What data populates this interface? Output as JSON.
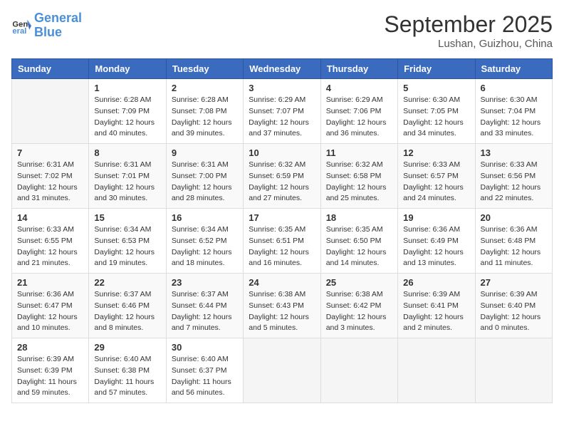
{
  "header": {
    "logo_line1": "General",
    "logo_line2": "Blue",
    "month": "September 2025",
    "location": "Lushan, Guizhou, China"
  },
  "days_of_week": [
    "Sunday",
    "Monday",
    "Tuesday",
    "Wednesday",
    "Thursday",
    "Friday",
    "Saturday"
  ],
  "weeks": [
    [
      {
        "day": "",
        "info": ""
      },
      {
        "day": "1",
        "info": "Sunrise: 6:28 AM\nSunset: 7:09 PM\nDaylight: 12 hours\nand 40 minutes."
      },
      {
        "day": "2",
        "info": "Sunrise: 6:28 AM\nSunset: 7:08 PM\nDaylight: 12 hours\nand 39 minutes."
      },
      {
        "day": "3",
        "info": "Sunrise: 6:29 AM\nSunset: 7:07 PM\nDaylight: 12 hours\nand 37 minutes."
      },
      {
        "day": "4",
        "info": "Sunrise: 6:29 AM\nSunset: 7:06 PM\nDaylight: 12 hours\nand 36 minutes."
      },
      {
        "day": "5",
        "info": "Sunrise: 6:30 AM\nSunset: 7:05 PM\nDaylight: 12 hours\nand 34 minutes."
      },
      {
        "day": "6",
        "info": "Sunrise: 6:30 AM\nSunset: 7:04 PM\nDaylight: 12 hours\nand 33 minutes."
      }
    ],
    [
      {
        "day": "7",
        "info": "Sunrise: 6:31 AM\nSunset: 7:02 PM\nDaylight: 12 hours\nand 31 minutes."
      },
      {
        "day": "8",
        "info": "Sunrise: 6:31 AM\nSunset: 7:01 PM\nDaylight: 12 hours\nand 30 minutes."
      },
      {
        "day": "9",
        "info": "Sunrise: 6:31 AM\nSunset: 7:00 PM\nDaylight: 12 hours\nand 28 minutes."
      },
      {
        "day": "10",
        "info": "Sunrise: 6:32 AM\nSunset: 6:59 PM\nDaylight: 12 hours\nand 27 minutes."
      },
      {
        "day": "11",
        "info": "Sunrise: 6:32 AM\nSunset: 6:58 PM\nDaylight: 12 hours\nand 25 minutes."
      },
      {
        "day": "12",
        "info": "Sunrise: 6:33 AM\nSunset: 6:57 PM\nDaylight: 12 hours\nand 24 minutes."
      },
      {
        "day": "13",
        "info": "Sunrise: 6:33 AM\nSunset: 6:56 PM\nDaylight: 12 hours\nand 22 minutes."
      }
    ],
    [
      {
        "day": "14",
        "info": "Sunrise: 6:33 AM\nSunset: 6:55 PM\nDaylight: 12 hours\nand 21 minutes."
      },
      {
        "day": "15",
        "info": "Sunrise: 6:34 AM\nSunset: 6:53 PM\nDaylight: 12 hours\nand 19 minutes."
      },
      {
        "day": "16",
        "info": "Sunrise: 6:34 AM\nSunset: 6:52 PM\nDaylight: 12 hours\nand 18 minutes."
      },
      {
        "day": "17",
        "info": "Sunrise: 6:35 AM\nSunset: 6:51 PM\nDaylight: 12 hours\nand 16 minutes."
      },
      {
        "day": "18",
        "info": "Sunrise: 6:35 AM\nSunset: 6:50 PM\nDaylight: 12 hours\nand 14 minutes."
      },
      {
        "day": "19",
        "info": "Sunrise: 6:36 AM\nSunset: 6:49 PM\nDaylight: 12 hours\nand 13 minutes."
      },
      {
        "day": "20",
        "info": "Sunrise: 6:36 AM\nSunset: 6:48 PM\nDaylight: 12 hours\nand 11 minutes."
      }
    ],
    [
      {
        "day": "21",
        "info": "Sunrise: 6:36 AM\nSunset: 6:47 PM\nDaylight: 12 hours\nand 10 minutes."
      },
      {
        "day": "22",
        "info": "Sunrise: 6:37 AM\nSunset: 6:46 PM\nDaylight: 12 hours\nand 8 minutes."
      },
      {
        "day": "23",
        "info": "Sunrise: 6:37 AM\nSunset: 6:44 PM\nDaylight: 12 hours\nand 7 minutes."
      },
      {
        "day": "24",
        "info": "Sunrise: 6:38 AM\nSunset: 6:43 PM\nDaylight: 12 hours\nand 5 minutes."
      },
      {
        "day": "25",
        "info": "Sunrise: 6:38 AM\nSunset: 6:42 PM\nDaylight: 12 hours\nand 3 minutes."
      },
      {
        "day": "26",
        "info": "Sunrise: 6:39 AM\nSunset: 6:41 PM\nDaylight: 12 hours\nand 2 minutes."
      },
      {
        "day": "27",
        "info": "Sunrise: 6:39 AM\nSunset: 6:40 PM\nDaylight: 12 hours\nand 0 minutes."
      }
    ],
    [
      {
        "day": "28",
        "info": "Sunrise: 6:39 AM\nSunset: 6:39 PM\nDaylight: 11 hours\nand 59 minutes."
      },
      {
        "day": "29",
        "info": "Sunrise: 6:40 AM\nSunset: 6:38 PM\nDaylight: 11 hours\nand 57 minutes."
      },
      {
        "day": "30",
        "info": "Sunrise: 6:40 AM\nSunset: 6:37 PM\nDaylight: 11 hours\nand 56 minutes."
      },
      {
        "day": "",
        "info": ""
      },
      {
        "day": "",
        "info": ""
      },
      {
        "day": "",
        "info": ""
      },
      {
        "day": "",
        "info": ""
      }
    ]
  ]
}
